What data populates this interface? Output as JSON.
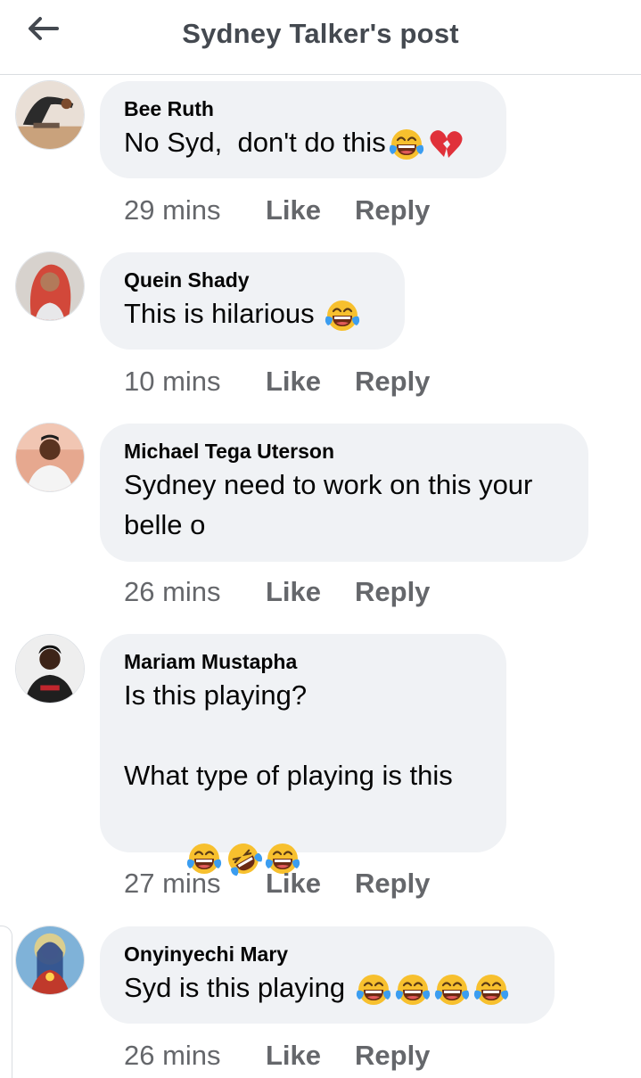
{
  "header": {
    "title": "Sydney Talker's post",
    "back_icon": "arrow-left-icon"
  },
  "labels": {
    "like": "Like",
    "reply": "Reply"
  },
  "comments": [
    {
      "author": "Bee Ruth",
      "text": "No Syd,  don't do this",
      "emojis": [
        "face-with-tears-of-joy",
        "broken-heart"
      ],
      "time": "29 mins"
    },
    {
      "author": "Quein Shady",
      "text": "This is hilarious",
      "emojis": [
        "face-with-tears-of-joy"
      ],
      "time": "10 mins"
    },
    {
      "author": "Michael Tega Uterson",
      "text": "Sydney need to work on this your belle o",
      "emojis": [],
      "time": "26 mins"
    },
    {
      "author": "Mariam Mustapha",
      "text_line1": "Is this playing?",
      "text_line2": "What type of playing is this",
      "emojis": [
        "face-with-tears-of-joy",
        "rolling-on-the-floor-laughing",
        "face-with-tears-of-joy"
      ],
      "time": "27 mins"
    },
    {
      "author": "Onyinyechi Mary",
      "text": "Syd is this playing",
      "emojis": [
        "face-with-tears-of-joy",
        "face-with-tears-of-joy",
        "face-with-tears-of-joy",
        "face-with-tears-of-joy"
      ],
      "time": "26 mins"
    }
  ],
  "colors": {
    "bubble": "#f0f2f5",
    "secondary_text": "#65676b",
    "title": "#444950",
    "emoji_face": "#f7c02e",
    "emoji_tear": "#3b9df0",
    "heart": "#e0313a"
  }
}
